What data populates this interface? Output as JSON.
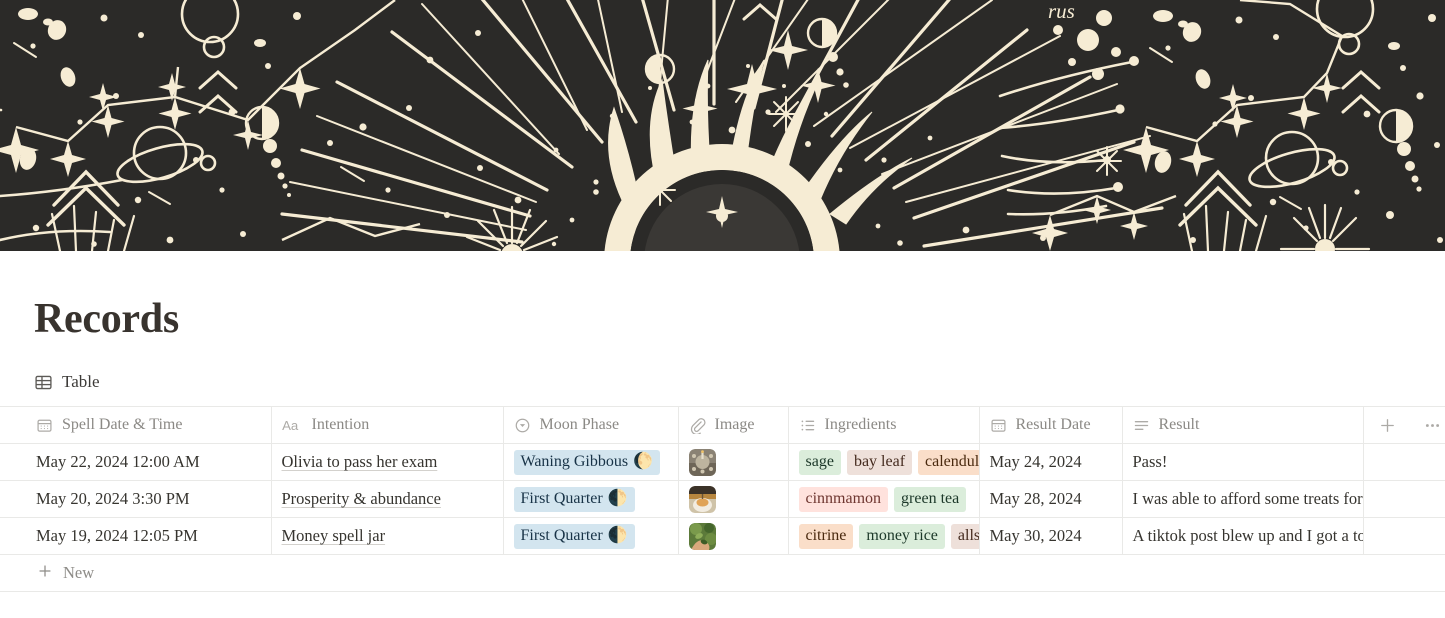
{
  "cover": {
    "name": "celestial-astrology-cover",
    "bg_color": "#2b2a28",
    "ink_color": "#f6ecd4",
    "label_text": "rus"
  },
  "page": {
    "title": "Records"
  },
  "views": [
    {
      "icon": "table-icon",
      "label": "Table"
    }
  ],
  "table": {
    "columns": [
      {
        "key": "spell_date",
        "label": "Spell Date & Time",
        "icon": "calendar-icon",
        "type": "date"
      },
      {
        "key": "intention",
        "label": "Intention",
        "icon": "title-aa-icon",
        "type": "title"
      },
      {
        "key": "moon_phase",
        "label": "Moon Phase",
        "icon": "select-icon",
        "type": "select"
      },
      {
        "key": "image",
        "label": "Image",
        "icon": "paperclip-icon",
        "type": "files"
      },
      {
        "key": "ingredients",
        "label": "Ingredients",
        "icon": "multi-select-icon",
        "type": "multi_select"
      },
      {
        "key": "result_date",
        "label": "Result Date",
        "icon": "calendar-icon",
        "type": "date"
      },
      {
        "key": "result",
        "label": "Result",
        "icon": "text-lines-icon",
        "type": "text"
      }
    ],
    "header_controls": [
      {
        "name": "add-column-button",
        "icon": "plus-icon"
      },
      {
        "name": "column-options-button",
        "icon": "ellipsis-icon"
      }
    ],
    "rows": [
      {
        "spell_date": "May 22, 2024 12:00 AM",
        "intention": "Olivia to pass her exam",
        "moon_phase": {
          "label": "Waning Gibbous",
          "emoji": "🌔",
          "bg": "#d3e5ef",
          "fg": "#183347"
        },
        "image": {
          "name": "spell-jar-thumbnail"
        },
        "ingredients": [
          {
            "label": "sage",
            "bg": "#dbeddb",
            "fg": "#1c3829"
          },
          {
            "label": "bay leaf",
            "bg": "#eee0da",
            "fg": "#442a1e"
          },
          {
            "label": "calendula",
            "bg": "#fadec9",
            "fg": "#49290e"
          }
        ],
        "result_date": "May 24, 2024",
        "result": "Pass!"
      },
      {
        "spell_date": "May 20, 2024 3:30 PM",
        "intention": "Prosperity & abundance",
        "moon_phase": {
          "label": "First Quarter",
          "emoji": "🌓",
          "bg": "#d3e5ef",
          "fg": "#183347"
        },
        "image": {
          "name": "candle-bowl-thumbnail"
        },
        "ingredients": [
          {
            "label": "cinnmamon",
            "bg": "#ffe2dd",
            "fg": "#6e3630"
          },
          {
            "label": "green tea",
            "bg": "#dbeddb",
            "fg": "#1c3829"
          }
        ],
        "result_date": "May 28, 2024",
        "result": "I was able to afford some treats for"
      },
      {
        "spell_date": "May 19, 2024 12:05 PM",
        "intention": "Money spell jar",
        "moon_phase": {
          "label": "First Quarter",
          "emoji": "🌓",
          "bg": "#d3e5ef",
          "fg": "#183347"
        },
        "image": {
          "name": "herbs-in-hand-thumbnail"
        },
        "ingredients": [
          {
            "label": "citrine",
            "bg": "#fadec9",
            "fg": "#49290e"
          },
          {
            "label": "money rice",
            "bg": "#dbeddb",
            "fg": "#1c3829"
          },
          {
            "label": "allspice",
            "bg": "#eee0da",
            "fg": "#442a1e"
          }
        ],
        "result_date": "May 30, 2024",
        "result": "A tiktok post blew up and I got a ton"
      }
    ],
    "new_row": {
      "icon": "plus-icon",
      "label": "New"
    }
  }
}
